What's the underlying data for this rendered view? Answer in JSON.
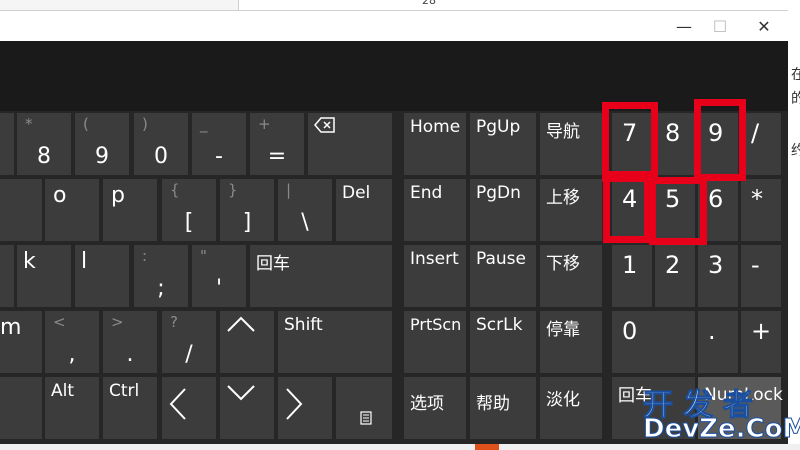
{
  "topbar": {
    "text": "28"
  },
  "window": {
    "minimize": "—",
    "maximize": "☐",
    "close": "✕"
  },
  "keys": {
    "star": {
      "sup": "*",
      "main": "8"
    },
    "lparen": {
      "sup": "(",
      "main": "9"
    },
    "rparen": {
      "sup": ")",
      "main": "0"
    },
    "minus": {
      "sup": "_",
      "main": "-"
    },
    "equals": {
      "sup": "+",
      "main": "="
    },
    "o": "o",
    "p": "p",
    "lbrace": {
      "sup": "{",
      "main": "["
    },
    "rbrace": {
      "sup": "}",
      "main": "]"
    },
    "pipe": {
      "sup": "|",
      "main": "\\"
    },
    "del": "Del",
    "k": "k",
    "l": "l",
    "semicolon": {
      "sup": ":",
      "main": ";"
    },
    "quote": {
      "sup": "\"",
      "main": "'"
    },
    "enter": "回车",
    "m": "m",
    "comma": {
      "sup": "<",
      "main": ","
    },
    "period": {
      "sup": ">",
      "main": "."
    },
    "slash": {
      "sup": "?",
      "main": "/"
    },
    "shift": "Shift",
    "alt": "Alt",
    "ctrl": "Ctrl",
    "home": "Home",
    "pgup": "PgUp",
    "nav": "导航",
    "end": "End",
    "pgdn": "PgDn",
    "moveup": "上移",
    "insert": "Insert",
    "pause": "Pause",
    "movedown": "下移",
    "prtscn": "PrtScn",
    "scrlk": "ScrLk",
    "dock": "停靠",
    "options": "选项",
    "help": "帮助",
    "fade": "淡化",
    "num7": "7",
    "num8": "8",
    "num9": "9",
    "numdiv": "/",
    "num4": "4",
    "num5": "5",
    "num6": "6",
    "nummul": "*",
    "num1": "1",
    "num2": "2",
    "num3": "3",
    "numsub": "-",
    "num0": "0",
    "numdot": ".",
    "numadd": "+",
    "numenter": "回车",
    "numlock": "NumLock"
  },
  "watermark": {
    "top": "开发者",
    "bottom": "DevZe.CoM"
  },
  "right_edge": {
    "a": "在",
    "b": "的",
    "c": "约"
  },
  "colors": {
    "key": "#3c3c3c",
    "keyboard": "#262626",
    "highlight": "#e8001a",
    "text": "#ffffff",
    "dim": "#8a8a8a"
  }
}
